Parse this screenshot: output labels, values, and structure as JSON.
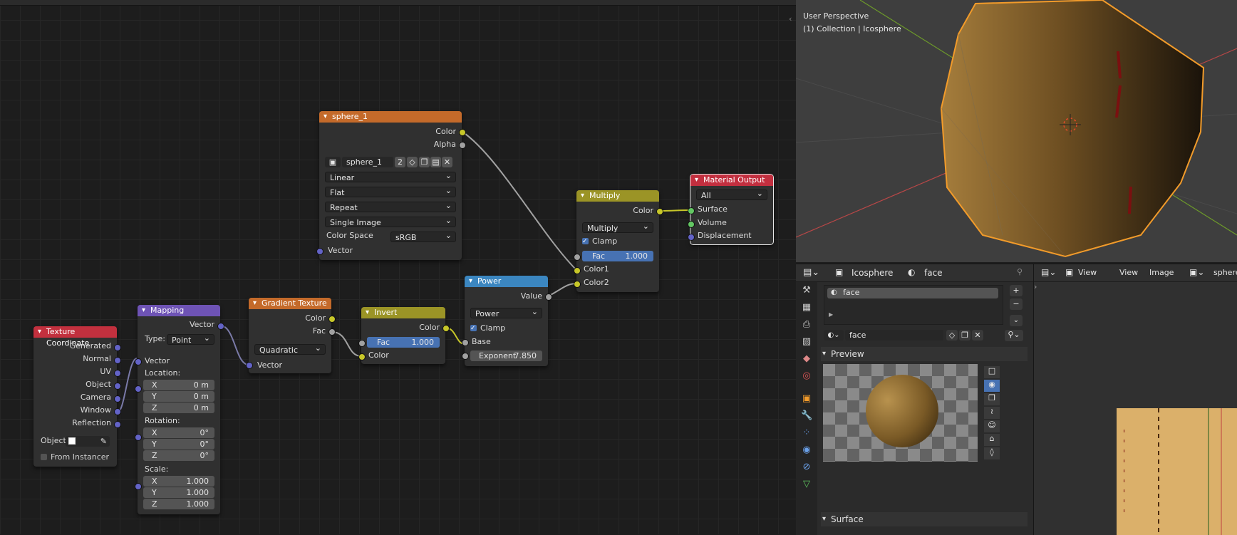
{
  "viewport": {
    "perspective_label": "User Perspective",
    "collection_label": "(1) Collection | Icosphere"
  },
  "nodes": {
    "texcoord": {
      "title": "Texture Coordinate",
      "outputs": [
        "Generated",
        "Normal",
        "UV",
        "Object",
        "Camera",
        "Window",
        "Reflection"
      ],
      "object_label": "Object:",
      "from_instancer": "From Instancer"
    },
    "mapping": {
      "title": "Mapping",
      "output": "Vector",
      "type_label": "Type:",
      "type_value": "Point",
      "input_vector": "Vector",
      "location_label": "Location:",
      "location": [
        {
          "axis": "X",
          "value": "0 m"
        },
        {
          "axis": "Y",
          "value": "0 m"
        },
        {
          "axis": "Z",
          "value": "0 m"
        }
      ],
      "rotation_label": "Rotation:",
      "rotation": [
        {
          "axis": "X",
          "value": "0°"
        },
        {
          "axis": "Y",
          "value": "0°"
        },
        {
          "axis": "Z",
          "value": "0°"
        }
      ],
      "scale_label": "Scale:",
      "scale": [
        {
          "axis": "X",
          "value": "1.000"
        },
        {
          "axis": "Y",
          "value": "1.000"
        },
        {
          "axis": "Z",
          "value": "1.000"
        }
      ]
    },
    "gradient": {
      "title": "Gradient Texture",
      "out_color": "Color",
      "out_fac": "Fac",
      "type_value": "Quadratic",
      "input_vector": "Vector"
    },
    "invert": {
      "title": "Invert",
      "out_color": "Color",
      "fac_label": "Fac",
      "fac_value": "1.000",
      "input_color": "Color",
      "fac_fill": 1.0
    },
    "power": {
      "title": "Power",
      "out_value": "Value",
      "op_value": "Power",
      "clamp_label": "Clamp",
      "base_label": "Base",
      "exponent_label": "Exponent",
      "exponent_value": "7.850"
    },
    "image": {
      "title": "sphere_1",
      "out_color": "Color",
      "out_alpha": "Alpha",
      "image_name": "sphere_1",
      "users": "2",
      "interp": "Linear",
      "projection": "Flat",
      "extension": "Repeat",
      "source": "Single Image",
      "colorspace_label": "Color Space",
      "colorspace_value": "sRGB",
      "input_vector": "Vector"
    },
    "multiply": {
      "title": "Multiply",
      "out_color": "Color",
      "op_value": "Multiply",
      "clamp_label": "Clamp",
      "fac_label": "Fac",
      "fac_value": "1.000",
      "color1": "Color1",
      "color2": "Color2",
      "fac_fill": 1.0
    },
    "output": {
      "title": "Material Output",
      "target": "All",
      "surface": "Surface",
      "volume": "Volume",
      "displacement": "Displacement"
    }
  },
  "properties": {
    "object_name": "Icosphere",
    "material_name": "face",
    "slot_item": "face",
    "material_field": "face",
    "preview_label": "Preview",
    "surface_label": "Surface"
  },
  "image_editor": {
    "view_menu": "View",
    "view_menu2": "View",
    "image_menu": "Image",
    "image_name": "sphere"
  },
  "colors": {
    "texcoord_header": "#c2303e",
    "mapping_header": "#6e53b5",
    "texture_header": "#c46a2a",
    "converter_header": "#9b9426",
    "math_header": "#3b86c0",
    "output_header": "#c22f3f",
    "socket_color": "#c7c729",
    "socket_float": "#a1a1a1",
    "socket_vector": "#6363c7",
    "socket_shader": "#63c763",
    "selection": "#f5a623",
    "accent": "#4772b3"
  }
}
